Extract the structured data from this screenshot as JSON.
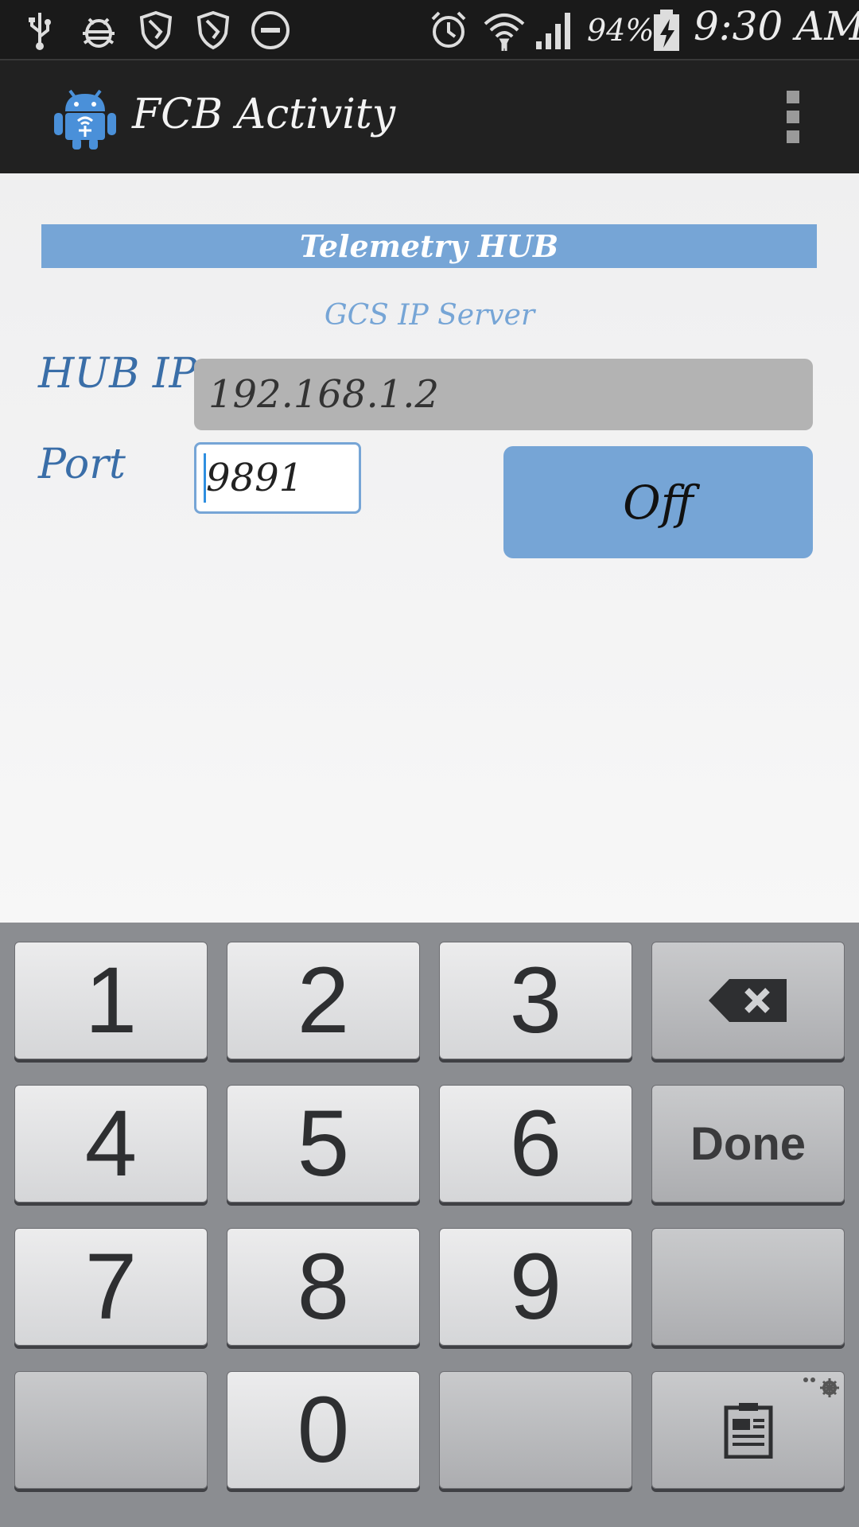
{
  "status_bar": {
    "icons": [
      "usb-icon",
      "bug-icon",
      "shield-icon",
      "shield-icon",
      "do-not-disturb-icon",
      "alarm-icon",
      "wifi-icon",
      "signal-icon",
      "battery-charging-icon"
    ],
    "battery": "94%",
    "time": "9:30 AM"
  },
  "action_bar": {
    "app_icon": "android-robot-icon",
    "title": "FCB Activity",
    "overflow_icon": "overflow-menu-icon"
  },
  "content": {
    "header": "Telemetry HUB",
    "subheader": "GCS IP Server",
    "hub_ip_label": "HUB IP",
    "hub_ip_value": "192.168.1.2",
    "port_label": "Port",
    "port_value": "9891",
    "toggle_label": "Off"
  },
  "keyboard": {
    "keys": [
      "1",
      "2",
      "3",
      "4",
      "5",
      "6",
      "7",
      "8",
      "9",
      "0"
    ],
    "done_label": "Done",
    "backspace_icon": "backspace-icon",
    "clipboard_icon": "clipboard-icon",
    "settings_icon": "settings-gear-icon"
  },
  "colors": {
    "accent": "#76a5d6",
    "label_blue": "#3a6ea8",
    "action_bar": "#212121",
    "status_bar": "#1a1a1a",
    "keyboard_bg": "#8b8d91"
  }
}
